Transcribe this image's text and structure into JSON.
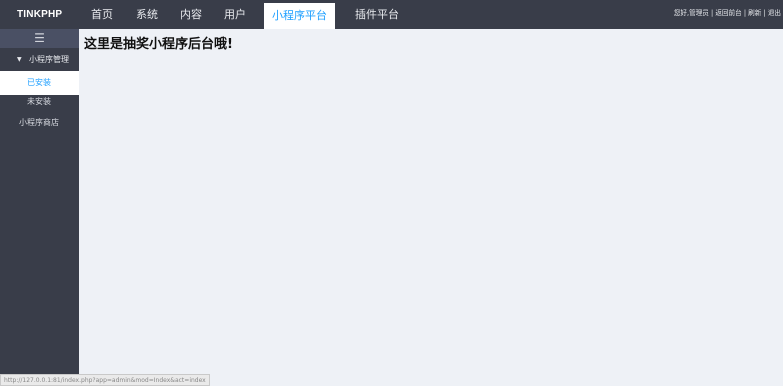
{
  "app": {
    "logo": "TINKPHP"
  },
  "topnav": {
    "items": [
      {
        "label": "首页"
      },
      {
        "label": "系统"
      },
      {
        "label": "内容"
      },
      {
        "label": "用户"
      },
      {
        "label": "小程序平台"
      },
      {
        "label": "插件平台"
      }
    ],
    "active_index": 4
  },
  "userbar": {
    "greeting": "您好,管理员",
    "separator": "|",
    "links": [
      "返回前台",
      "刷新",
      "退出"
    ]
  },
  "sidebar": {
    "toggle_icon": "menu-icon",
    "toggle_glyph": "☰",
    "group": {
      "label": "小程序管理",
      "expanded": true,
      "caret": "▼"
    },
    "items": [
      {
        "label": "已安装",
        "active": true
      },
      {
        "label": "未安装",
        "active": false
      },
      {
        "label": "小程序商店",
        "active": false
      }
    ]
  },
  "main": {
    "heading": "这里是抽奖小程序后台哦!"
  },
  "statusbar": {
    "url": "http://127.0.0.1:81/index.php?app=admin&mod=Index&act=index"
  },
  "colors": {
    "topbar_bg": "#393d49",
    "sidebar_bg": "#393d49",
    "toggle_bg": "#4a5064",
    "accent": "#1e9fff",
    "content_bg": "#eef1f6"
  }
}
